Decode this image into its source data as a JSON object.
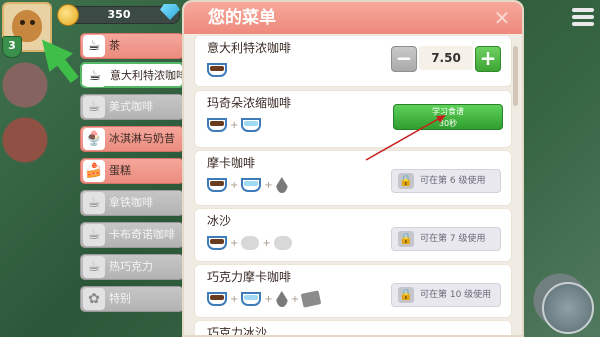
{
  "hud": {
    "level": "3",
    "coins": "350",
    "menu_icon": "hamburger-icon"
  },
  "categories": [
    {
      "label": "茶",
      "icon": "tea-cup-icon",
      "state": "active"
    },
    {
      "label": "意大利特浓咖啡",
      "icon": "espresso-cup-icon",
      "state": "selected"
    },
    {
      "label": "美式咖啡",
      "icon": "americano-icon",
      "state": "locked"
    },
    {
      "label": "冰淇淋与奶昔",
      "icon": "ice-cream-icon",
      "state": "active"
    },
    {
      "label": "蛋糕",
      "icon": "cake-icon",
      "state": "active"
    },
    {
      "label": "拿铁咖啡",
      "icon": "latte-icon",
      "state": "locked"
    },
    {
      "label": "卡布奇诺咖啡",
      "icon": "cappuccino-icon",
      "state": "locked"
    },
    {
      "label": "热巧克力",
      "icon": "hot-chocolate-icon",
      "state": "locked"
    },
    {
      "label": "特别",
      "icon": "special-icon",
      "state": "locked"
    }
  ],
  "panel": {
    "title": "您的菜单",
    "close_icon": "close-icon"
  },
  "items": [
    {
      "name": "意大利特浓咖啡",
      "price": "7.50"
    },
    {
      "name": "玛奇朵浓缩咖啡",
      "button_line1": "学习食谱",
      "button_line2": "30秒"
    },
    {
      "name": "摩卡咖啡",
      "lock_text": "可在第 6 级使用"
    },
    {
      "name": "冰沙",
      "lock_text": "可在第 7 级使用"
    },
    {
      "name": "巧克力摩卡咖啡",
      "lock_text": "可在第 10 级使用"
    },
    {
      "name": "巧克力冰沙"
    }
  ],
  "colors": {
    "header": "#ee897c",
    "accent_green": "#3ea536",
    "tutorial_arrow_green": "#3fbf4a",
    "tutorial_arrow_red": "#c8201e"
  }
}
